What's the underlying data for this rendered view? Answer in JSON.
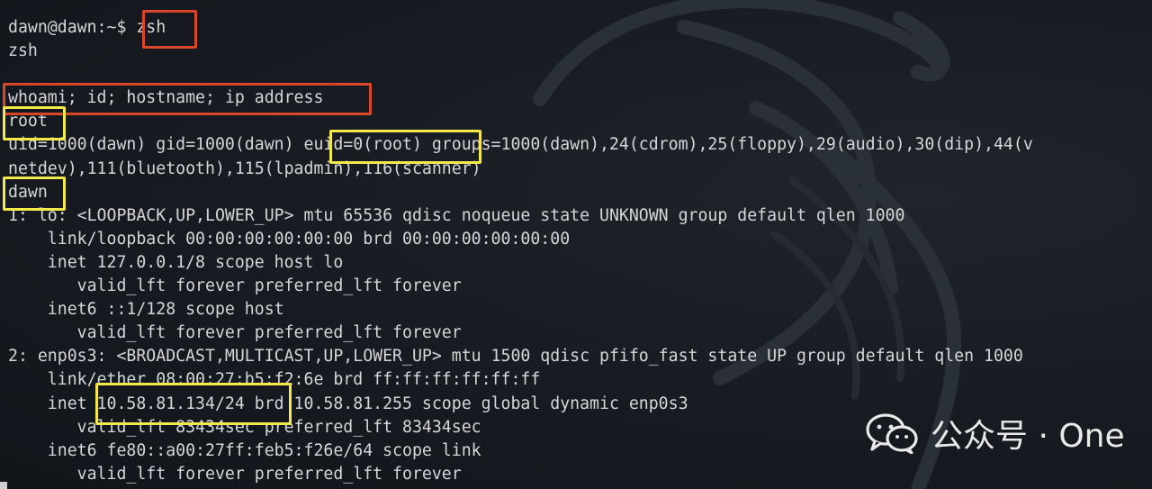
{
  "terminal": {
    "lines": [
      "dawn@dawn:~$ zsh",
      "zsh",
      "",
      "whoami; id; hostname; ip address",
      "root",
      "uid=1000(dawn) gid=1000(dawn) euid=0(root) groups=1000(dawn),24(cdrom),25(floppy),29(audio),30(dip),44(v",
      "netdev),111(bluetooth),115(lpadmin),116(scanner)",
      "dawn",
      "1: lo: <LOOPBACK,UP,LOWER_UP> mtu 65536 qdisc noqueue state UNKNOWN group default qlen 1000",
      "    link/loopback 00:00:00:00:00:00 brd 00:00:00:00:00:00",
      "    inet 127.0.0.1/8 scope host lo",
      "       valid_lft forever preferred_lft forever",
      "    inet6 ::1/128 scope host",
      "       valid_lft forever preferred_lft forever",
      "2: enp0s3: <BROADCAST,MULTICAST,UP,LOWER_UP> mtu 1500 qdisc pfifo_fast state UP group default qlen 1000",
      "    link/ether 08:00:27:b5:f2:6e brd ff:ff:ff:ff:ff:ff",
      "    inet 10.58.81.134/24 brd 10.58.81.255 scope global dynamic enp0s3",
      "       valid_lft 83434sec preferred_lft 83434sec",
      "    inet6 fe80::a00:27ff:feb5:f26e/64 scope link",
      "       valid_lft forever preferred_lft forever"
    ]
  },
  "watermark": {
    "text": "公众号 · One"
  },
  "highlight_colors": {
    "red": "#d9472b",
    "yellow": "#f3e94a"
  },
  "icons": {
    "watermark": "wechat-icon",
    "background": "kali-dragon-logo"
  }
}
